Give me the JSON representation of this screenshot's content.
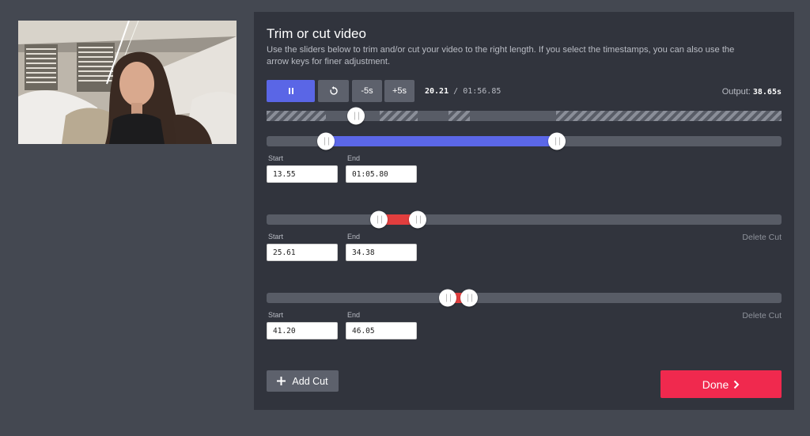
{
  "title": "Trim or cut video",
  "description": "Use the sliders below to trim and/or cut your video to the right length. If you select the timestamps, you can also use the arrow keys for finer adjustment.",
  "controls": {
    "play_icon": "pause-icon",
    "restart_icon": "restart-icon",
    "minus_label": "-5s",
    "plus_label": "+5s"
  },
  "playback": {
    "current": "20.21",
    "separator": "/",
    "duration": "01:56.85"
  },
  "output": {
    "label": "Output:",
    "value": "38.65s"
  },
  "trim": {
    "start_label": "Start",
    "end_label": "End",
    "start": "13.55",
    "end": "01:05.80"
  },
  "cuts": [
    {
      "start_label": "Start",
      "end_label": "End",
      "start": "25.61",
      "end": "34.38",
      "delete_label": "Delete Cut"
    },
    {
      "start_label": "Start",
      "end_label": "End",
      "start": "41.20",
      "end": "46.05",
      "delete_label": "Delete Cut"
    }
  ],
  "add_cut_label": "Add Cut",
  "done_label": "Done",
  "colors": {
    "accent": "#5a66e6",
    "cut": "#e23e3e",
    "done": "#f0294e",
    "panel": "#31343d",
    "background": "#444851"
  }
}
